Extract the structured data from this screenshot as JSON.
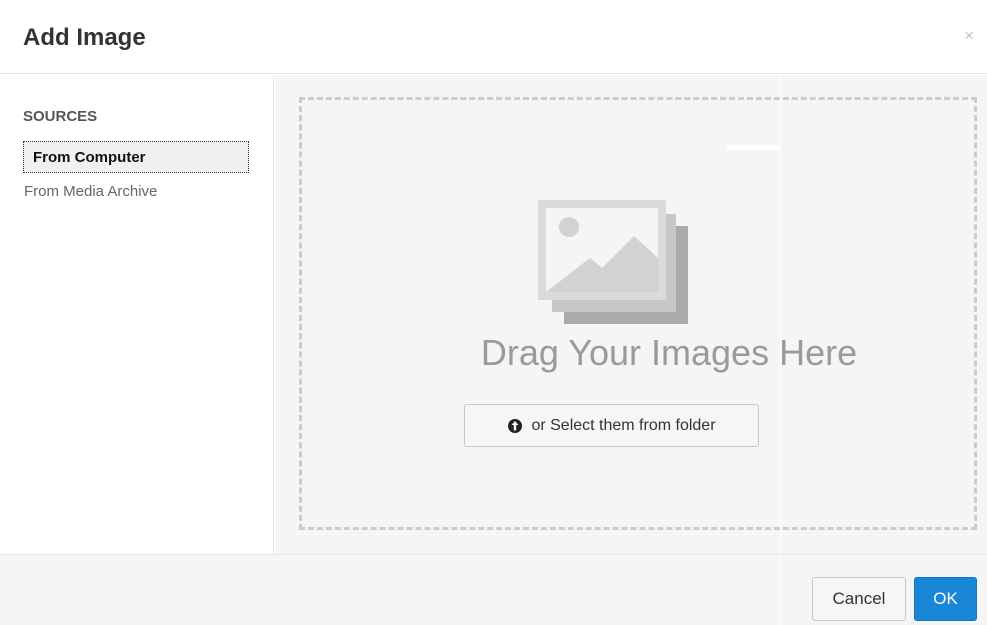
{
  "dialog": {
    "title": "Add Image",
    "close_symbol": "×"
  },
  "sidebar": {
    "section_label": "SOURCES",
    "items": [
      {
        "label": "From Computer",
        "active": true
      },
      {
        "label": "From Media Archive",
        "active": false
      }
    ]
  },
  "dropzone": {
    "icon": "image-placeholder-icon",
    "message": "Drag Your Images Here",
    "select_button_label": "or Select them from folder",
    "select_button_icon": "upload-icon"
  },
  "footer": {
    "cancel_label": "Cancel",
    "ok_label": "OK"
  },
  "colors": {
    "accent": "#1a87d6",
    "dropzone_border": "#cccccc",
    "panel_bg": "#f5f5f5"
  }
}
